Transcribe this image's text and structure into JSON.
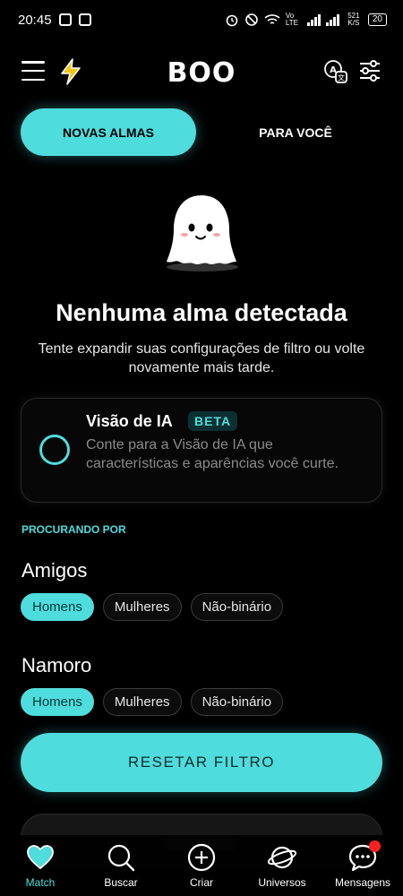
{
  "status_bar": {
    "time": "20:45",
    "network_label": "Vo LTE",
    "speed": "521 K/S",
    "battery": "20"
  },
  "header": {
    "logo": "BOO"
  },
  "tabs": [
    {
      "label": "NOVAS ALMAS",
      "active": true
    },
    {
      "label": "PARA VOCÊ",
      "active": false
    }
  ],
  "empty_state": {
    "title": "Nenhuma alma detectada",
    "subtitle": "Tente expandir suas configurações de filtro ou volte novamente mais tarde."
  },
  "ai_card": {
    "title": "Visão de IA",
    "badge": "BETA",
    "description": "Conte para a Visão de IA que características e aparências você curte."
  },
  "filters": {
    "section_label": "PROCURANDO POR",
    "friends": {
      "title": "Amigos",
      "options": [
        {
          "label": "Homens",
          "selected": true
        },
        {
          "label": "Mulheres",
          "selected": false
        },
        {
          "label": "Não-binário",
          "selected": false
        }
      ]
    },
    "dating": {
      "title": "Namoro",
      "options": [
        {
          "label": "Homens",
          "selected": true
        },
        {
          "label": "Mulheres",
          "selected": false
        },
        {
          "label": "Não-binário",
          "selected": false
        }
      ]
    },
    "reset_label": "RESETAR FILTRO"
  },
  "bottom_nav": [
    {
      "label": "Match",
      "icon": "heart-icon",
      "active": true
    },
    {
      "label": "Buscar",
      "icon": "search-icon",
      "active": false
    },
    {
      "label": "Criar",
      "icon": "plus-circle-icon",
      "active": false
    },
    {
      "label": "Universos",
      "icon": "planet-icon",
      "active": false
    },
    {
      "label": "Mensagens",
      "icon": "chat-bubble-icon",
      "active": false,
      "notification": true
    }
  ],
  "colors": {
    "accent": "#4fdcdc",
    "background": "#000000",
    "notification": "#ff2020"
  }
}
